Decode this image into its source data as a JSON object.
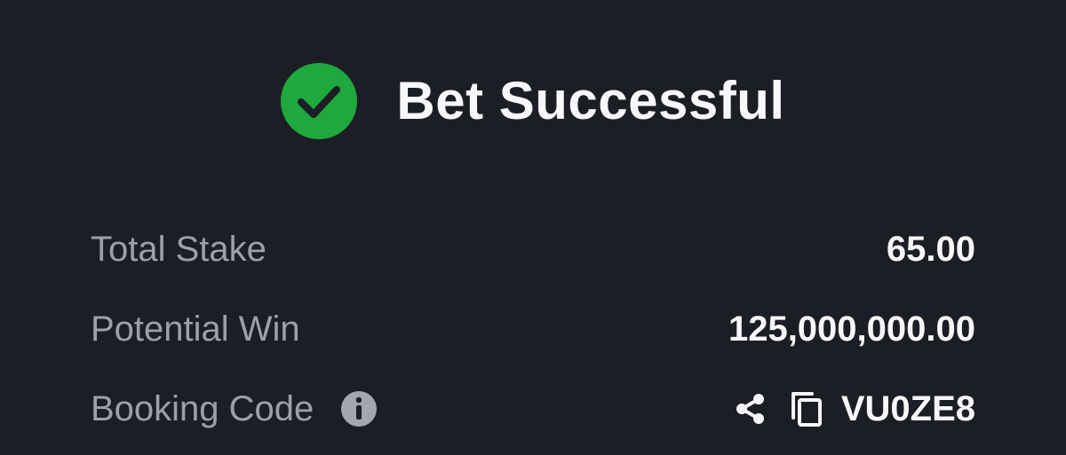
{
  "header": {
    "title": "Bet Successful",
    "icon": "check-circle-icon",
    "icon_color": "#1fa83d"
  },
  "details": {
    "total_stake": {
      "label": "Total Stake",
      "value": "65.00"
    },
    "potential_win": {
      "label": "Potential Win",
      "value": "125,000,000.00"
    },
    "booking_code": {
      "label": "Booking Code",
      "value": "VU0ZE8",
      "info_icon": "info-icon",
      "share_icon": "share-icon",
      "copy_icon": "copy-icon"
    }
  },
  "colors": {
    "background": "#1c1e25",
    "label": "#9ca0ac",
    "value": "#f7f7f9",
    "success": "#1fa83d"
  }
}
